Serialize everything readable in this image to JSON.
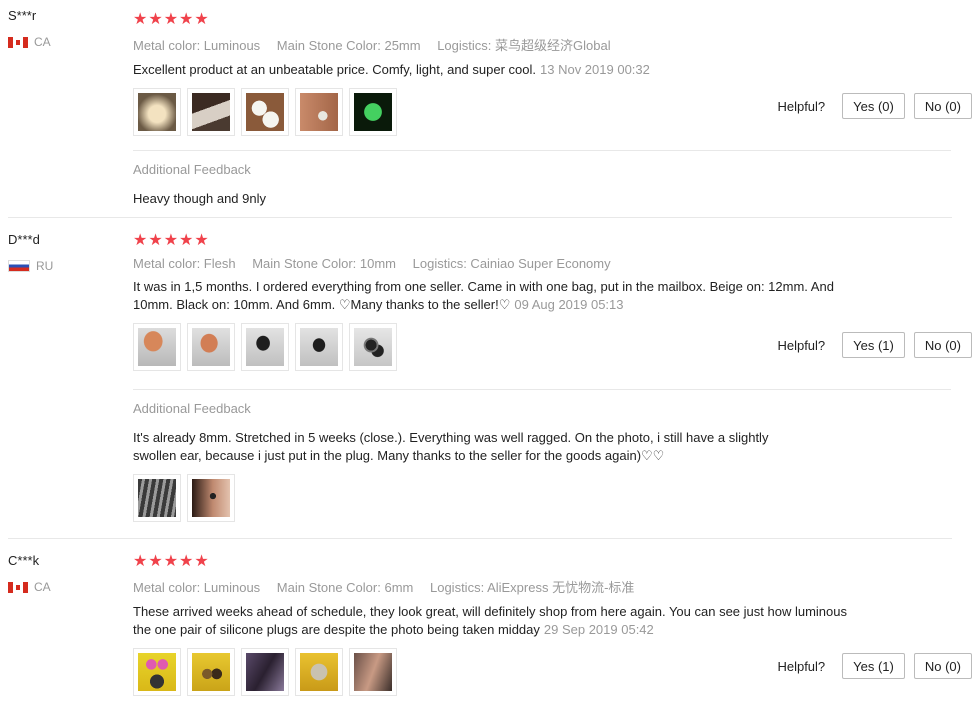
{
  "reviews": [
    {
      "user": "S***r",
      "country": "CA",
      "stars": "★★★★★",
      "metal": "Metal color: Luminous",
      "stone": "Main Stone Color: 25mm",
      "logistics": "Logistics: 菜鸟超级经济Global",
      "text": "Excellent product at an unbeatable price. Comfy, light, and super cool.",
      "date": "13 Nov 2019 00:32",
      "photos": [
        "candle-photo",
        "hand-photo",
        "white-plugs-photo",
        "ear-photo",
        "glow-plug-photo"
      ],
      "helpful_label": "Helpful?",
      "yes": "Yes (0)",
      "no": "No (0)",
      "additional_label": "Additional Feedback",
      "additional_text": "Heavy though and 9nly",
      "additional_photos": []
    },
    {
      "user": "D***d",
      "country": "RU",
      "stars": "★★★★★",
      "metal": "Metal color: Flesh",
      "stone": "Main Stone Color: 10mm",
      "logistics": "Logistics: Cainiao Super Economy",
      "text": "It was in 1,5 months. I ordered everything from one seller. Came in with one bag, put in the mailbox. Beige on: 12mm. And 10mm. Black on: 10mm. And 6mm. ♡Many thanks to the seller!♡",
      "date": "09 Aug 2019 05:13",
      "photos": [
        "beige-plug-photo",
        "beige-plug-photo-2",
        "black-plug-photo",
        "black-plug-photo-2",
        "black-plugs-pair-photo"
      ],
      "helpful_label": "Helpful?",
      "yes": "Yes (1)",
      "no": "No (0)",
      "additional_label": "Additional Feedback",
      "additional_text": "It's already 8mm. Stretched in 5 weeks (close.). Everything was well ragged. On the photo, i still have a slightly swollen ear, because i just put in the plug. Many thanks to the seller for the goods again)♡♡",
      "additional_photos": [
        "ear-plug-photo",
        "ear-side-photo"
      ]
    },
    {
      "user": "C***k",
      "country": "CA",
      "stars": "★★★★★",
      "metal": "Metal color: Luminous",
      "stone": "Main Stone Color: 6mm",
      "logistics": "Logistics: AliExpress 无忧物流-标准",
      "text": "These arrived weeks ahead of schedule, they look great, will definitely shop from here again. You can see just how luminous the one pair of silicone plugs are despite the photo being taken midday",
      "date": "29 Sep 2019 05:42",
      "photos": [
        "yellow-plugs-photo",
        "yellow-plugs-photo-2",
        "purple-plugs-photo",
        "package-photo",
        "face-photo"
      ],
      "helpful_label": "Helpful?",
      "yes": "Yes (1)",
      "no": "No (0)",
      "additional_label": "",
      "additional_text": "",
      "additional_photos": []
    }
  ]
}
